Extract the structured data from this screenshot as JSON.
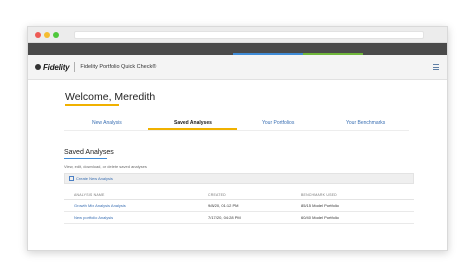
{
  "app": {
    "logo_text": "Fidelity",
    "title": "Fidelity Portfolio Quick Check®"
  },
  "welcome": {
    "text": "Welcome, Meredith"
  },
  "tabs": [
    {
      "label": "New Analysis"
    },
    {
      "label": "Saved Analyses"
    },
    {
      "label": "Your Portfolios"
    },
    {
      "label": "Your Benchmarks"
    }
  ],
  "saved": {
    "title": "Saved Analyses",
    "description": "View, edit, download, or delete saved analyses",
    "create_label": "Create New Analysis",
    "columns": [
      "ANALYSIS NAME",
      "CREATED",
      "BENCHMARK USED"
    ],
    "rows": [
      {
        "name": "Growth Mix Analysis Analysis",
        "created": "9/8/20, 01:12 PM",
        "benchmark": "85/15 Model Portfolio"
      },
      {
        "name": "New portfolio Analysis",
        "created": "7/17/20, 04:28 PM",
        "benchmark": "60/40 Model Portfolio"
      }
    ]
  },
  "colors": {
    "accent_yellow": "#f0b100",
    "link_blue": "#3a6fb3"
  },
  "icons": {
    "menu": "hamburger-menu-icon",
    "create": "add-document-icon"
  }
}
